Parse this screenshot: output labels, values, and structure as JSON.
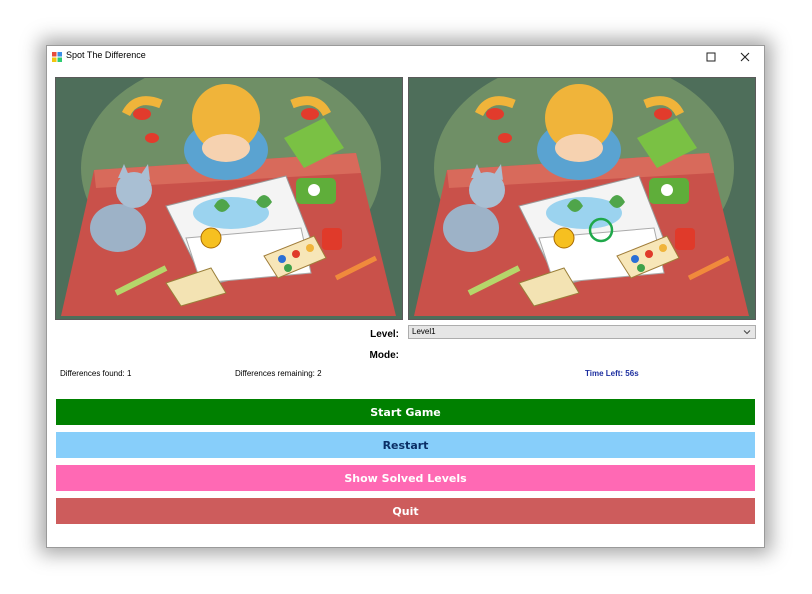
{
  "window": {
    "title": "Spot The Difference"
  },
  "form": {
    "level_label": "Level:",
    "level_value": "Level1",
    "mode_label": "Mode:"
  },
  "status": {
    "found": "Differences found: 1",
    "remaining": "Differences remaining: 2",
    "time_left": "Time Left: 56s"
  },
  "buttons": {
    "start": "Start Game",
    "restart": "Restart",
    "solved": "Show Solved Levels",
    "quit": "Quit"
  },
  "colors": {
    "start": "#008000",
    "restart": "#87cefa",
    "solved": "#ff69b4",
    "quit": "#cd5c5c",
    "time_left_text": "#1d2fa0",
    "found_marker": "#1fa84a"
  },
  "icons": {
    "app": "app-icon",
    "maximize": "maximize-icon",
    "close": "close-icon",
    "dropdown": "chevron-down-icon"
  }
}
